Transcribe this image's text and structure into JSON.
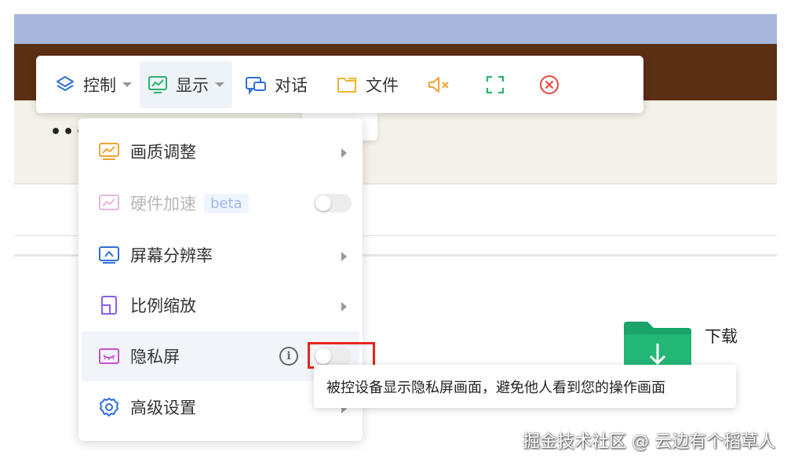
{
  "toolbar": {
    "control_label": "控制",
    "display_label": "显示",
    "chat_label": "对话",
    "file_label": "文件"
  },
  "menu": {
    "items": [
      {
        "label": "画质调整"
      },
      {
        "label": "硬件加速",
        "badge": "beta"
      },
      {
        "label": "屏幕分辨率"
      },
      {
        "label": "比例缩放"
      },
      {
        "label": "隐私屏"
      },
      {
        "label": "高级设置"
      }
    ]
  },
  "tooltip": {
    "text": "被控设备显示隐私屏画面，避免他人看到您的操作画面"
  },
  "desktop": {
    "folder_label": "下载",
    "dots": "•••"
  },
  "watermark": "掘金技术社区 @ 云边有个稻草人",
  "colors": {
    "accent_blue": "#2f6fd8",
    "highlight_red": "#e8231b",
    "mute_orange": "#f0a236",
    "close_red": "#e8473d",
    "fullscreen_green": "#27b36b",
    "folder_green": "#1aa36b"
  }
}
